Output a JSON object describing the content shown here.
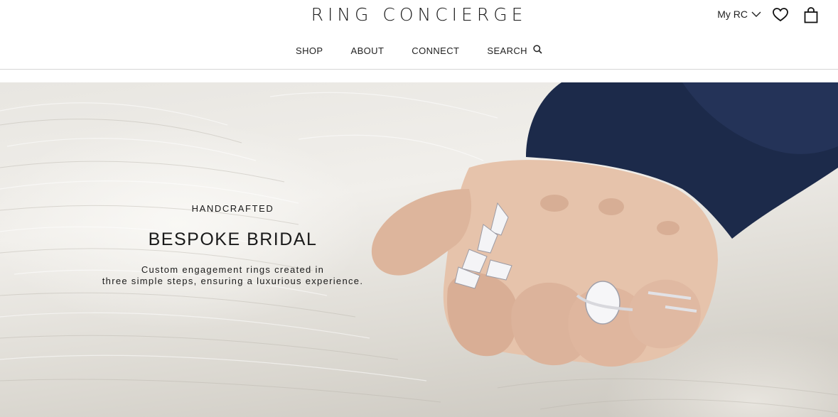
{
  "brand": {
    "logo_text": "RING CONCIERGE"
  },
  "account": {
    "label": "My RC"
  },
  "icons": {
    "chevron": "chevron-down-icon",
    "wishlist": "heart-icon",
    "cart": "shopping-bag-icon",
    "search": "search-icon"
  },
  "nav": {
    "shop": "SHOP",
    "about": "ABOUT",
    "connect": "CONNECT",
    "search": "SEARCH"
  },
  "hero": {
    "eyebrow": "HANDCRAFTED",
    "headline": "BESPOKE BRIDAL",
    "subtext_line1": "Custom engagement rings created in",
    "subtext_line2": "three simple steps, ensuring a luxurious experience."
  },
  "colors": {
    "text": "#1a1a1a",
    "divider": "#d6d6d6",
    "sleeve": "#1c2a4a",
    "skin": "#e3bfa8"
  }
}
